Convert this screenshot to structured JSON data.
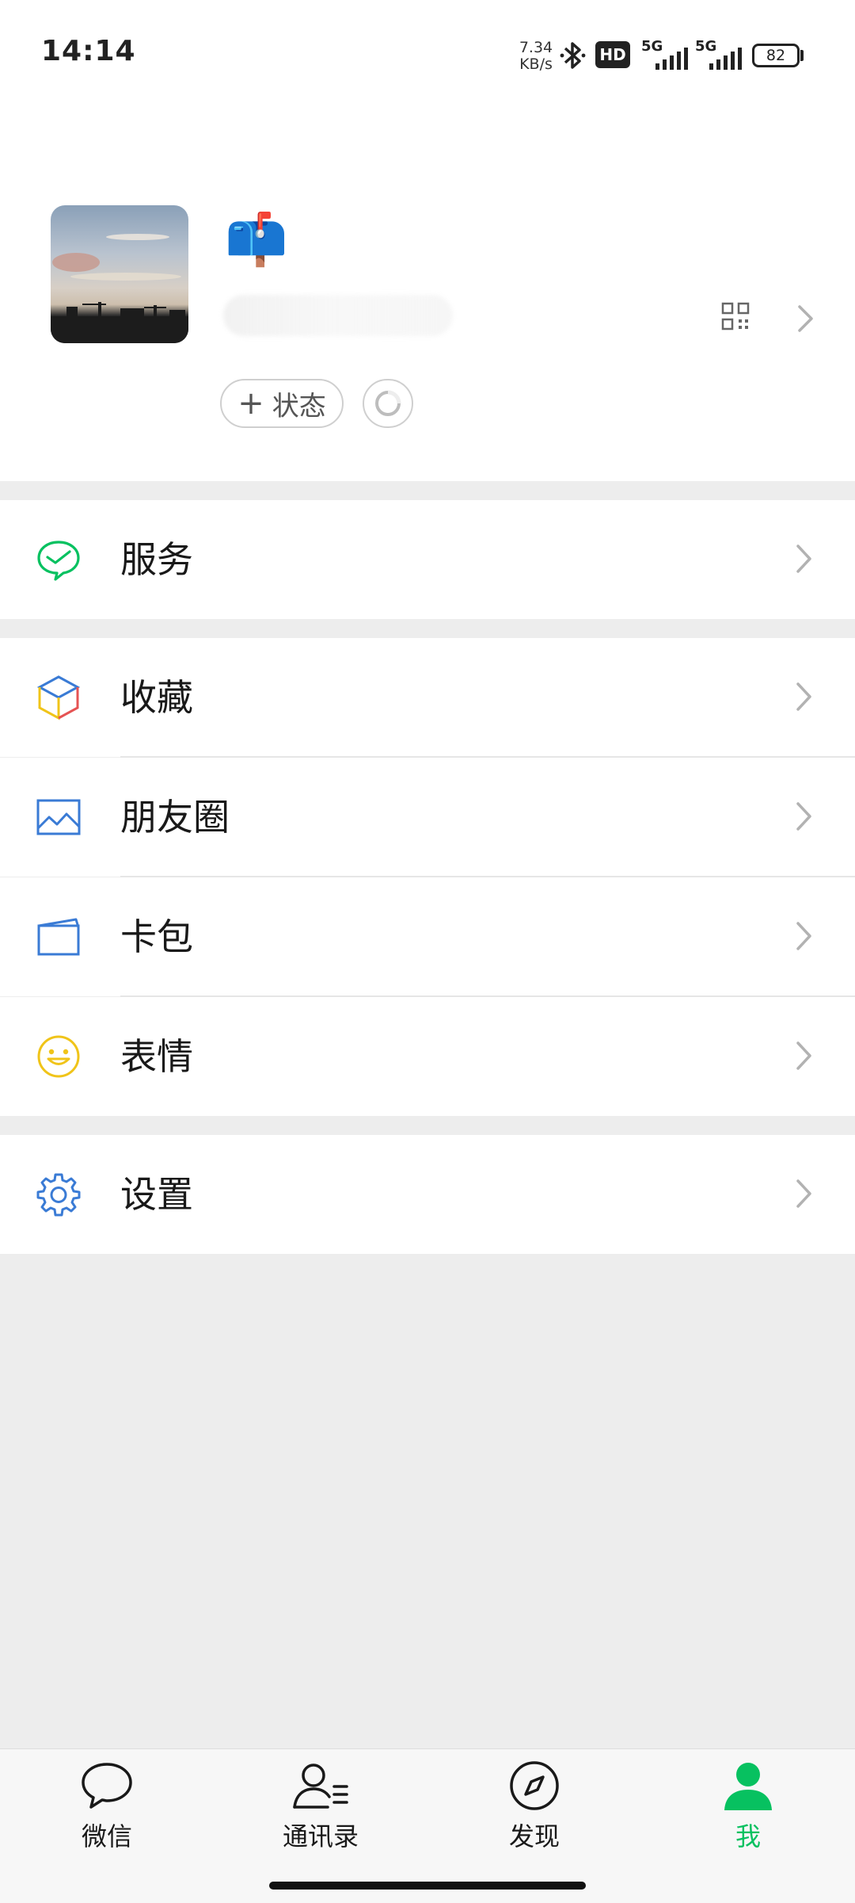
{
  "status_bar": {
    "time": "14:14",
    "net_speed_value": "7.34",
    "net_speed_unit": "KB/s",
    "hd_label": "HD",
    "sim1_label": "5G",
    "sim2_label": "5G",
    "battery": "82"
  },
  "profile": {
    "nickname": "📫",
    "status_button_label": "状态",
    "status_button_plus": "+"
  },
  "menu": {
    "services": "服务",
    "favorites": "收藏",
    "moments": "朋友圈",
    "card_wallet": "卡包",
    "stickers": "表情",
    "settings": "设置"
  },
  "tabs": [
    {
      "label": "微信",
      "icon": "chat-bubble-icon"
    },
    {
      "label": "通讯录",
      "icon": "contacts-icon"
    },
    {
      "label": "发现",
      "icon": "compass-icon"
    },
    {
      "label": "我",
      "icon": "me-person-icon"
    }
  ],
  "colors": {
    "accent": "#07c160",
    "background": "#ededed"
  }
}
